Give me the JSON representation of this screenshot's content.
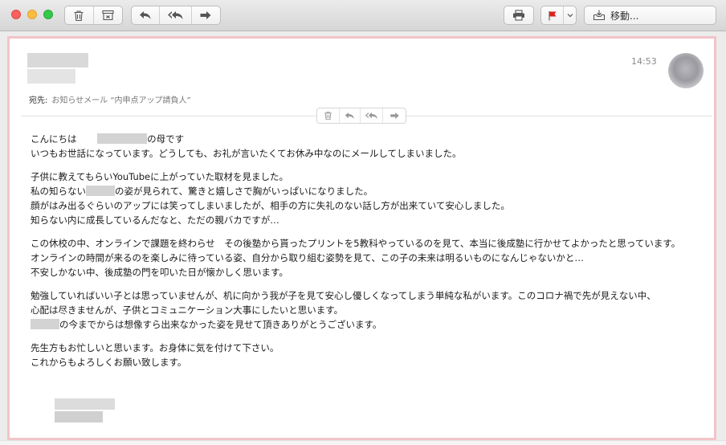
{
  "toolbar": {
    "delete_icon": "trash-icon",
    "archive_icon": "archive-icon",
    "reply_icon": "reply-icon",
    "reply_all_icon": "reply-all-icon",
    "forward_icon": "forward-icon",
    "print_icon": "printer-icon",
    "flag_icon": "flag-icon",
    "flag_color": "#e0211b",
    "move_label": "移動..."
  },
  "message": {
    "time": "14:53",
    "to_label": "宛先:",
    "to_value": "お知らせメール “内申点アップ請負人”",
    "body": {
      "p1": {
        "l1_pre": "こんにちは",
        "l1_post": "の母です",
        "l2": "いつもお世話になっています。どうしても、お礼が言いたくてお休み中なのにメールしてしまいました。"
      },
      "p2": {
        "l1": "子供に教えてもらいYouTubeに上がっていた取材を見ました。",
        "l2_pre": "私の知らない",
        "l2_post": "の姿が見られて、驚きと嬉しさで胸がいっぱいになりました。",
        "l3": "顔がはみ出るぐらいのアップには笑ってしまいましたが、相手の方に失礼のない話し方が出来ていて安心しました。",
        "l4": "知らない内に成長しているんだなと、ただの親バカですが…"
      },
      "p3": {
        "l1": "この休校の中、オンラインで課題を終わらせ　その後塾から貰ったプリントを5教科やっているのを見て、本当に後成塾に行かせてよかったと思っています。",
        "l2": "オンラインの時間が来るのを楽しみに待っている姿、自分から取り組む姿勢を見て、この子の未来は明るいものになんじゃないかと…",
        "l3": "不安しかない中、後成塾の門を叩いた日が懐かしく思います。"
      },
      "p4": {
        "l1": "勉強していればいい子とは思っていませんが、机に向かう我が子を見て安心し優しくなってしまう単純な私がいます。このコロナ禍で先が見えない中、",
        "l2": "心配は尽きませんが、子供とコミュニケーション大事にしたいと思います。",
        "l3_post": "の今までからは想像すら出来なかった姿を見せて頂きありがとうございます。"
      },
      "p5": {
        "l1": "先生方もお忙しいと思います。お身体に気を付けて下さい。",
        "l2": "これからもよろしくお願い致します。"
      }
    }
  },
  "colors": {
    "frame_border": "#f2c4c8",
    "close": "#fc605c",
    "minimize": "#fdbc40",
    "zoom": "#34c84a"
  }
}
